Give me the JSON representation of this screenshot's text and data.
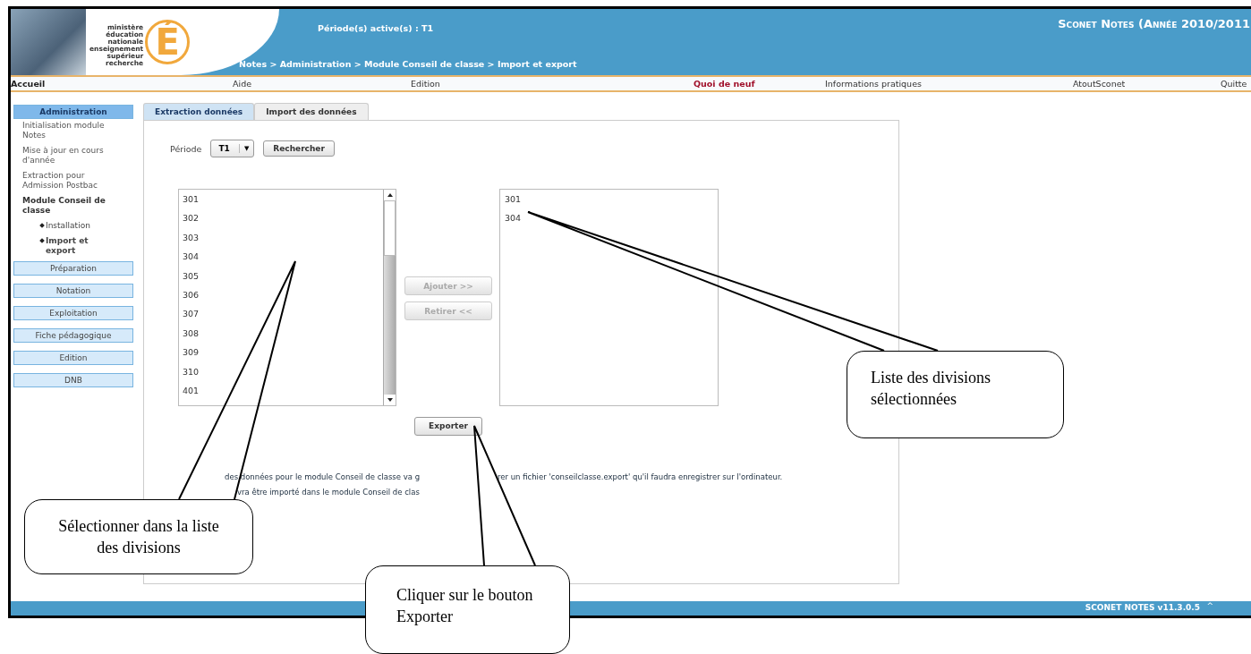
{
  "header": {
    "logo_text": [
      "ministère",
      "éducation",
      "nationale",
      "enseignement",
      "supérieur",
      "recherche"
    ],
    "logo_letter": "É",
    "active_periods": "Période(s) active(s) : T1",
    "breadcrumb": "Notes > Administration > Module Conseil de classe > Import et export",
    "app_title": "Sconet Notes (Année 2010/2011"
  },
  "nav": [
    {
      "label": "Accueil",
      "kind": "home"
    },
    {
      "label": "Aide",
      "kind": "normal"
    },
    {
      "label": "Edition",
      "kind": "normal"
    },
    {
      "label": "Quoi de neuf",
      "kind": "news"
    },
    {
      "label": "Informations pratiques",
      "kind": "normal"
    },
    {
      "label": "AtoutSconet",
      "kind": "normal"
    },
    {
      "label": "Quitte",
      "kind": "normal"
    }
  ],
  "sidebar": [
    {
      "label": "Administration",
      "selected": true,
      "items": [
        {
          "label": "Initialisation module Notes",
          "selected": false
        },
        {
          "label": "Mise à jour en cours d'année",
          "selected": false
        },
        {
          "label": "Extraction pour Admission Postbac",
          "selected": false
        },
        {
          "label": "Module Conseil de classe",
          "selected": true,
          "children": [
            {
              "label": "Installation",
              "selected": false
            },
            {
              "label": "Import et export",
              "selected": true
            }
          ]
        }
      ]
    },
    {
      "label": "Préparation",
      "selected": false
    },
    {
      "label": "Notation",
      "selected": false
    },
    {
      "label": "Exploitation",
      "selected": false
    },
    {
      "label": "Fiche pédagogique",
      "selected": false
    },
    {
      "label": "Edition",
      "selected": false
    },
    {
      "label": "DNB",
      "selected": false
    }
  ],
  "tabs": [
    {
      "label": "Extraction données",
      "selected": true
    },
    {
      "label": "Import des données",
      "selected": false
    }
  ],
  "period": {
    "label": "Période",
    "value": "T1",
    "caret": "▼"
  },
  "search_button": {
    "label": "Rechercher",
    "disabled": false
  },
  "available_divisions": [
    "301",
    "302",
    "303",
    "304",
    "305",
    "306",
    "307",
    "308",
    "309",
    "310",
    "401"
  ],
  "transfer_buttons": [
    {
      "label": "Ajouter >>",
      "disabled": true
    },
    {
      "label": "Retirer <<",
      "disabled": true
    }
  ],
  "selected_divisions": [
    "301",
    "304"
  ],
  "export_button": {
    "label": "Exporter",
    "disabled": false
  },
  "info_lines": [
    [
      "des données pour le module Conseil de classe va g",
      "rer un fichier 'conseilclasse.export' qu'il faudra enregistrer sur l'ordinateur."
    ],
    [
      "vra être importé dans le module Conseil de clas"
    ]
  ],
  "footer": {
    "version": "SCONET NOTES v11.3.0.5",
    "caret": "^"
  },
  "callouts": [
    {
      "text": "Sélectionner dans la liste des divisions",
      "kind": "left-list"
    },
    {
      "text": "Liste des divisions sélectionnées",
      "kind": "right-list"
    },
    {
      "text": "Cliquer sur le bouton  Exporter",
      "kind": "export"
    }
  ]
}
